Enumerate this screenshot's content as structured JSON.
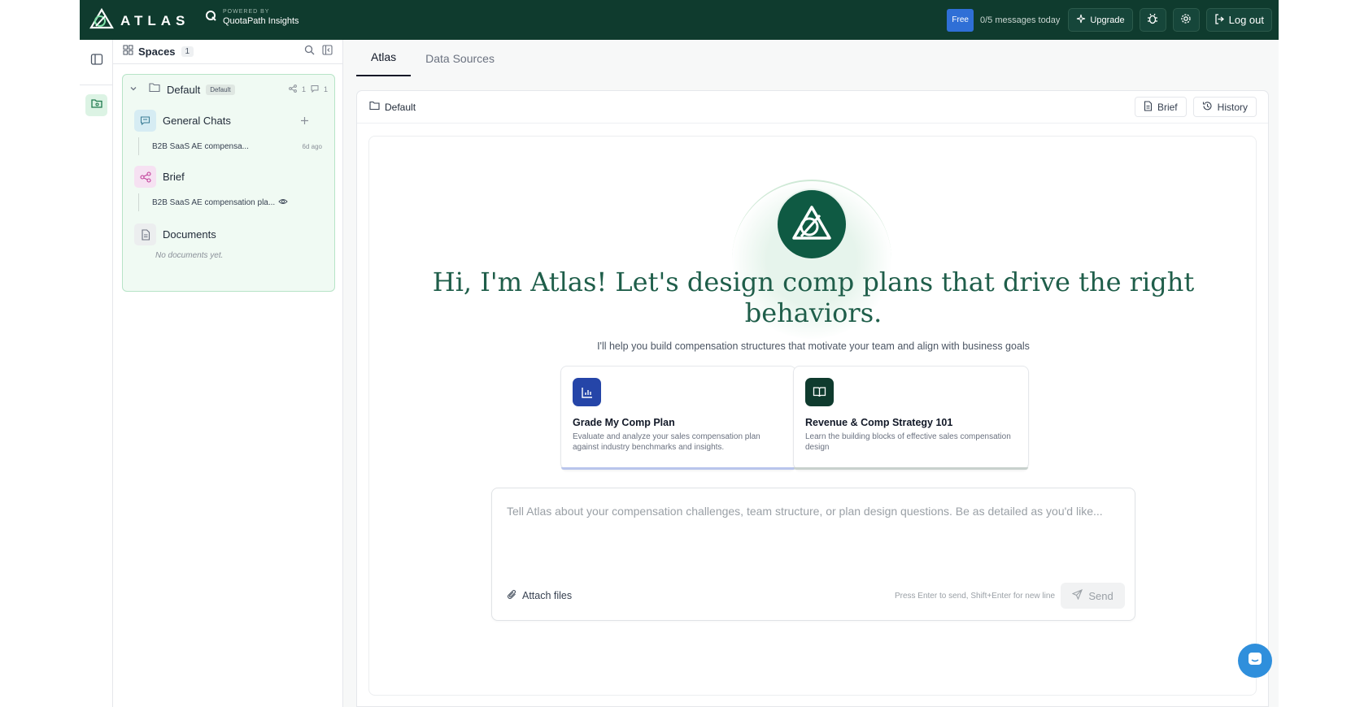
{
  "topbar": {
    "logo_word": "ATLAS",
    "powered_by": "POWERED BY",
    "powered_name": "QuotaPath Insights",
    "plan_badge": "Free",
    "message_count": "0/5 messages today",
    "upgrade_label": "Upgrade",
    "logout_label": "Log out"
  },
  "sidebar": {
    "title": "Spaces",
    "count": "1",
    "space": {
      "name": "Default",
      "tag": "Default",
      "shares": "1",
      "comments": "1"
    },
    "sections": {
      "general_chats": {
        "label": "General Chats",
        "items": [
          {
            "title": "B2B SaaS AE compensa...",
            "time": "6d ago"
          }
        ]
      },
      "brief": {
        "label": "Brief",
        "items": [
          {
            "title": "B2B SaaS AE compensation pla..."
          }
        ]
      },
      "documents": {
        "label": "Documents",
        "empty": "No documents yet."
      }
    }
  },
  "main": {
    "tabs": [
      {
        "label": "Atlas"
      },
      {
        "label": "Data Sources"
      }
    ],
    "breadcrumb": "Default",
    "brief_button": "Brief",
    "history_button": "History",
    "hero": {
      "title": "Hi, I'm Atlas! Let's design comp plans that drive the right behaviors.",
      "subtitle": "I'll help you build compensation structures that motivate your team and align with business goals"
    },
    "cards": [
      {
        "title": "Grade My Comp Plan",
        "description": "Evaluate and analyze your sales compensation plan against industry benchmarks and insights.",
        "color": "#2545a8"
      },
      {
        "title": "Revenue & Comp Strategy 101",
        "description": "Learn the building blocks of effective sales compensation design",
        "color": "#0f3b2e"
      }
    ],
    "composer": {
      "placeholder": "Tell Atlas about your compensation challenges, team structure, or plan design questions. Be as detailed as you'd like...",
      "attach_label": "Attach files",
      "hint": "Press Enter to send, Shift+Enter for new line",
      "send_label": "Send"
    }
  },
  "colors": {
    "topbar": "#0f3b2e",
    "accent_green": "#1f5e4a",
    "free_badge": "#2f6fd6",
    "chat_fab": "#2f8fdc"
  }
}
